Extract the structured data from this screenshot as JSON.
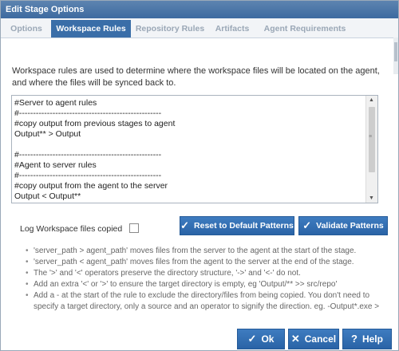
{
  "window": {
    "title": "Edit Stage Options"
  },
  "tabs": [
    {
      "label": "Options"
    },
    {
      "label": "Workspace Rules"
    },
    {
      "label": "Repository Rules"
    },
    {
      "label": "Artifacts"
    },
    {
      "label": "Agent Requirements"
    }
  ],
  "description": "Workspace rules are used to determine where the workspace files will be located on the agent, and where the files will be synced back to.",
  "editor": {
    "lines": [
      "#Server to agent rules",
      "#---------------------------------------------------",
      "#copy output from previous stages to agent",
      "Output** > Output",
      "",
      "#---------------------------------------------------",
      "#Agent to server rules",
      "#---------------------------------------------------",
      "#copy output from the agent to the server",
      "Output < Output**"
    ]
  },
  "options": {
    "log_label": "Log Workspace files copied"
  },
  "buttons": {
    "reset": "Reset to Default Patterns",
    "validate": "Validate Patterns",
    "ok": "Ok",
    "cancel": "Cancel",
    "help": "Help"
  },
  "help_items": [
    "'server_path > agent_path' moves files from the server to the agent at the start of the stage.",
    "'server_path < agent_path' moves files from the agent to the server at the end of the stage.",
    "The '>' and '<' operators preserve the directory structure, '->' and '<-' do not.",
    "Add an extra '<' or '>' to ensure the target directory is empty, eg 'Output/** >> src/repo'",
    "Add a - at the start of the rule to exclude the directory/files from being copied. You don't need to specify a target directory, only a source and an operator to signify the direction. eg. -Output*.exe >"
  ],
  "icons": {
    "check": "check-icon",
    "close": "close-icon",
    "help": "question-icon"
  },
  "colors": {
    "accent": "#3a6ea8",
    "title_bar": "#4a76a8",
    "button": "#2f6bb0"
  }
}
